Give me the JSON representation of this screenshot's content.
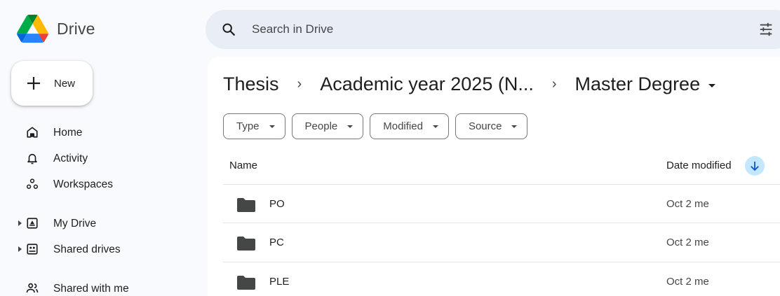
{
  "app": {
    "name": "Drive",
    "colors": {
      "accent": "#c2e7ff",
      "background": "#f8fafd",
      "search_bg": "#e9eef6"
    }
  },
  "search": {
    "placeholder": "Search in Drive",
    "icon": "search-icon",
    "options_icon": "tune-icon"
  },
  "new_button": {
    "label": "New",
    "icon": "plus-icon"
  },
  "sidebar": {
    "items": [
      {
        "label": "Home",
        "icon": "home-icon"
      },
      {
        "label": "Activity",
        "icon": "bell-icon"
      },
      {
        "label": "Workspaces",
        "icon": "workspaces-icon"
      },
      {
        "label": "My Drive",
        "icon": "my-drive-icon",
        "expandable": true
      },
      {
        "label": "Shared drives",
        "icon": "shared-drives-icon",
        "expandable": true
      },
      {
        "label": "Shared with me",
        "icon": "shared-with-me-icon"
      }
    ]
  },
  "breadcrumb": {
    "items": [
      "Thesis",
      "Academic year 2025 (N...",
      "Master Degree"
    ],
    "separator": "›"
  },
  "filters": [
    "Type",
    "People",
    "Modified",
    "Source"
  ],
  "table": {
    "columns": {
      "name": "Name",
      "date_modified": "Date modified"
    },
    "sort": "descending",
    "rows": [
      {
        "name": "PO",
        "date": "Oct 2 me"
      },
      {
        "name": "PC",
        "date": "Oct 2 me"
      },
      {
        "name": "PLE",
        "date": "Oct 2 me"
      }
    ]
  }
}
